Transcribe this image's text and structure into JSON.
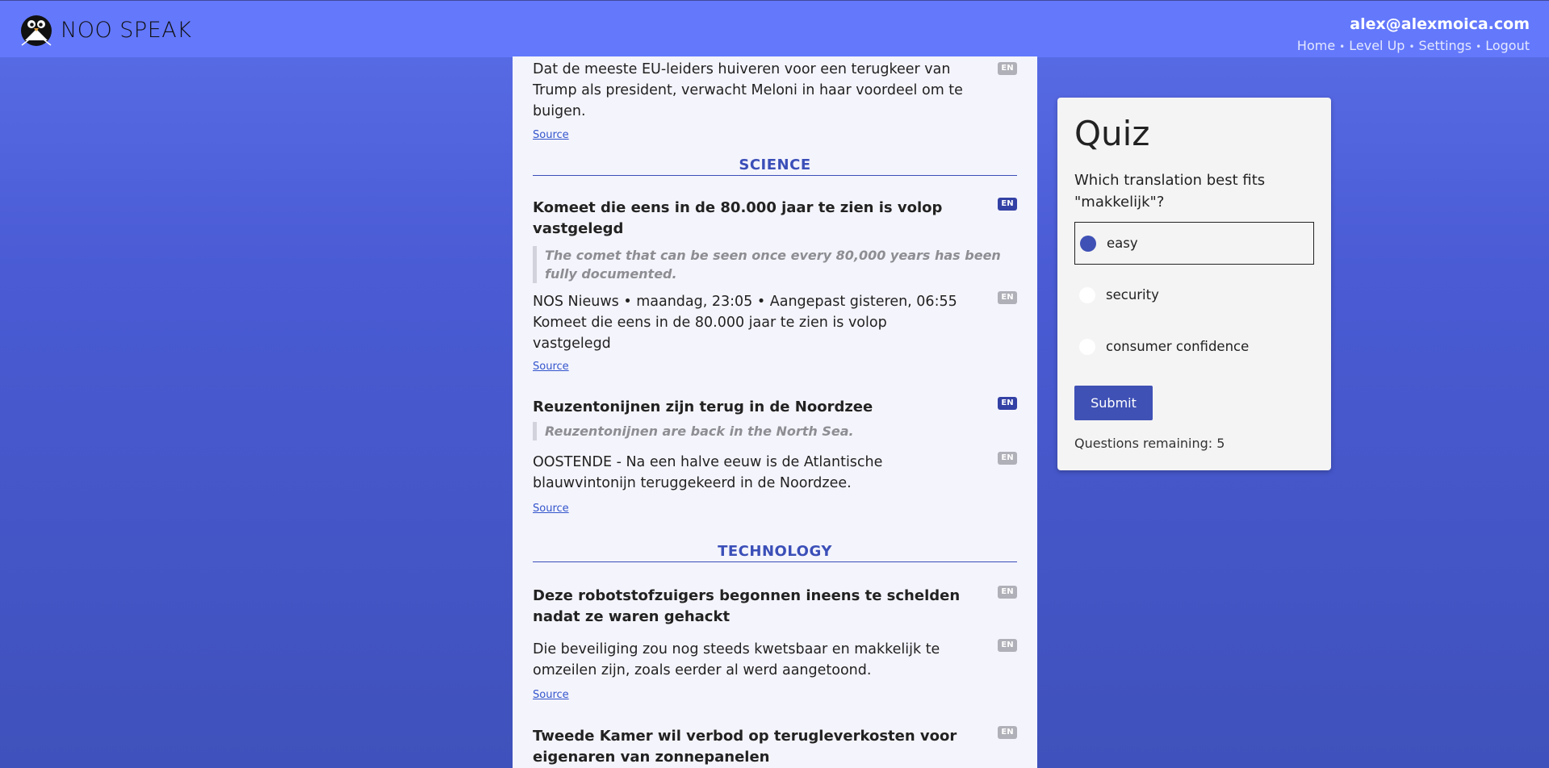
{
  "header": {
    "logo_text": "NOO SPEAK",
    "user_email": "alex@alexmoica.com",
    "nav": [
      "Home",
      "Level Up",
      "Settings",
      "Logout"
    ]
  },
  "feed": {
    "top_item": {
      "body": "Dat de meeste EU-leiders huiveren voor een terugkeer van Trump als president, verwacht Meloni in haar voordeel om te buigen.",
      "badge": "EN",
      "source": "Source"
    },
    "sections": [
      {
        "heading": "SCIENCE",
        "items": [
          {
            "title": "Komeet die eens in de 80.000 jaar te zien is volop vastgelegd",
            "title_badge": "EN",
            "translation": "The comet that can be seen once every 80,000 years has been fully documented.",
            "body": "NOS Nieuws • maandag, 23:05 • Aangepast gisteren, 06:55 Komeet die eens in de 80.000 jaar te zien is volop vastgelegd",
            "body_badge": "EN",
            "source": "Source"
          },
          {
            "title": "Reuzentonijnen zijn terug in de Noordzee",
            "title_badge": "EN",
            "translation": "Reuzentonijnen are back in the North Sea.",
            "body": "OOSTENDE - Na een halve eeuw is de Atlantische blauwvintonijn teruggekeerd in de Noordzee.",
            "body_badge": "EN",
            "source": "Source"
          }
        ]
      },
      {
        "heading": "TECHNOLOGY",
        "items": [
          {
            "title": "Deze robotstofzuigers begonnen ineens te schelden nadat ze waren gehackt",
            "title_badge": "EN",
            "body": "Die beveiliging zou nog steeds kwetsbaar en makkelijk te omzeilen zijn, zoals eerder al werd aangetoond.",
            "body_badge": "EN",
            "source": "Source"
          },
          {
            "title": "Tweede Kamer wil verbod op terugleverkosten voor eigenaren van zonnepanelen",
            "title_badge": "EN"
          }
        ]
      }
    ]
  },
  "quiz": {
    "title": "Quiz",
    "question": "Which translation best fits \"makkelijk\"?",
    "options": [
      "easy",
      "security",
      "consumer confidence"
    ],
    "selected": "easy",
    "submit_label": "Submit",
    "remaining": "Questions remaining: 5"
  },
  "colors": {
    "header_bg": "#6378fb",
    "accent": "#3f51b5",
    "section_heading": "#3b4fb8"
  }
}
